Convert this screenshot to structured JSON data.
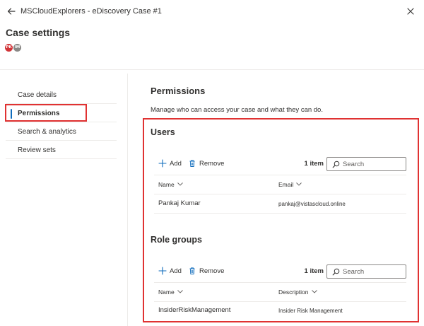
{
  "topbar": {
    "title": "MSCloudExplorers - eDiscovery Case #1",
    "back_icon": "arrow-left-icon",
    "close_icon": "close-icon"
  },
  "page": {
    "title": "Case settings",
    "avatars": [
      {
        "initials": "PK",
        "color": "#d13438"
      },
      {
        "initials": "IM",
        "color": "#8a8886"
      }
    ]
  },
  "nav": {
    "items": [
      {
        "label": "Case details",
        "active": false
      },
      {
        "label": "Permissions",
        "active": true
      },
      {
        "label": "Search & analytics",
        "active": false
      },
      {
        "label": "Review sets",
        "active": false
      }
    ],
    "accent_color": "#0f6cbd",
    "highlight_color": "#e03232"
  },
  "main": {
    "title": "Permissions",
    "description": "Manage who can access your case and what they can do."
  },
  "users": {
    "title": "Users",
    "add_label": "Add",
    "remove_label": "Remove",
    "count": "1 item",
    "search_placeholder": "Search",
    "columns": [
      "Name",
      "Email"
    ],
    "rows": [
      {
        "name": "Pankaj Kumar",
        "email": "pankaj@vistascloud.online"
      }
    ]
  },
  "role_groups": {
    "title": "Role groups",
    "add_label": "Add",
    "remove_label": "Remove",
    "count": "1 item",
    "search_placeholder": "Search",
    "columns": [
      "Name",
      "Description"
    ],
    "rows": [
      {
        "name": "InsiderRiskManagement",
        "description": "Insider Risk Management"
      }
    ]
  }
}
